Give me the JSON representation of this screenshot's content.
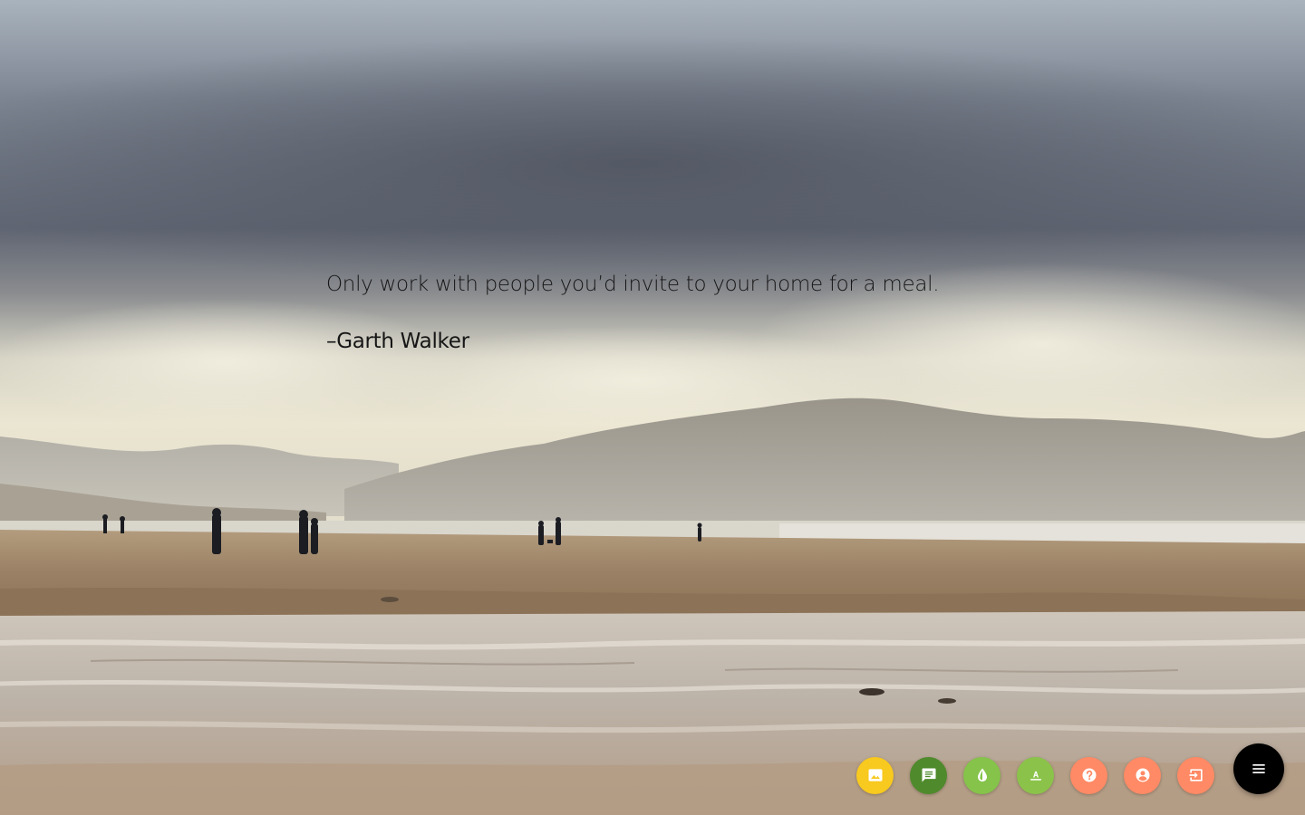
{
  "quote": {
    "text": "Only work with people you’d invite to your home for a meal.",
    "author": "–Garth Walker"
  },
  "toolbar": {
    "buttons": [
      {
        "id": "background",
        "icon": "image-icon",
        "color": "#f8c91e"
      },
      {
        "id": "quote",
        "icon": "message-icon",
        "color": "#4f8a2c"
      },
      {
        "id": "theme",
        "icon": "drop-icon",
        "color": "#85c34a"
      },
      {
        "id": "font",
        "icon": "text-format-icon",
        "color": "#8bc34a"
      },
      {
        "id": "help",
        "icon": "help-icon",
        "color": "#ff8a65"
      },
      {
        "id": "account",
        "icon": "account-icon",
        "color": "#ff8a65"
      },
      {
        "id": "exit",
        "icon": "exit-icon",
        "color": "#ff8a65"
      }
    ],
    "menu": {
      "icon": "menu-icon",
      "color": "#000000"
    }
  }
}
